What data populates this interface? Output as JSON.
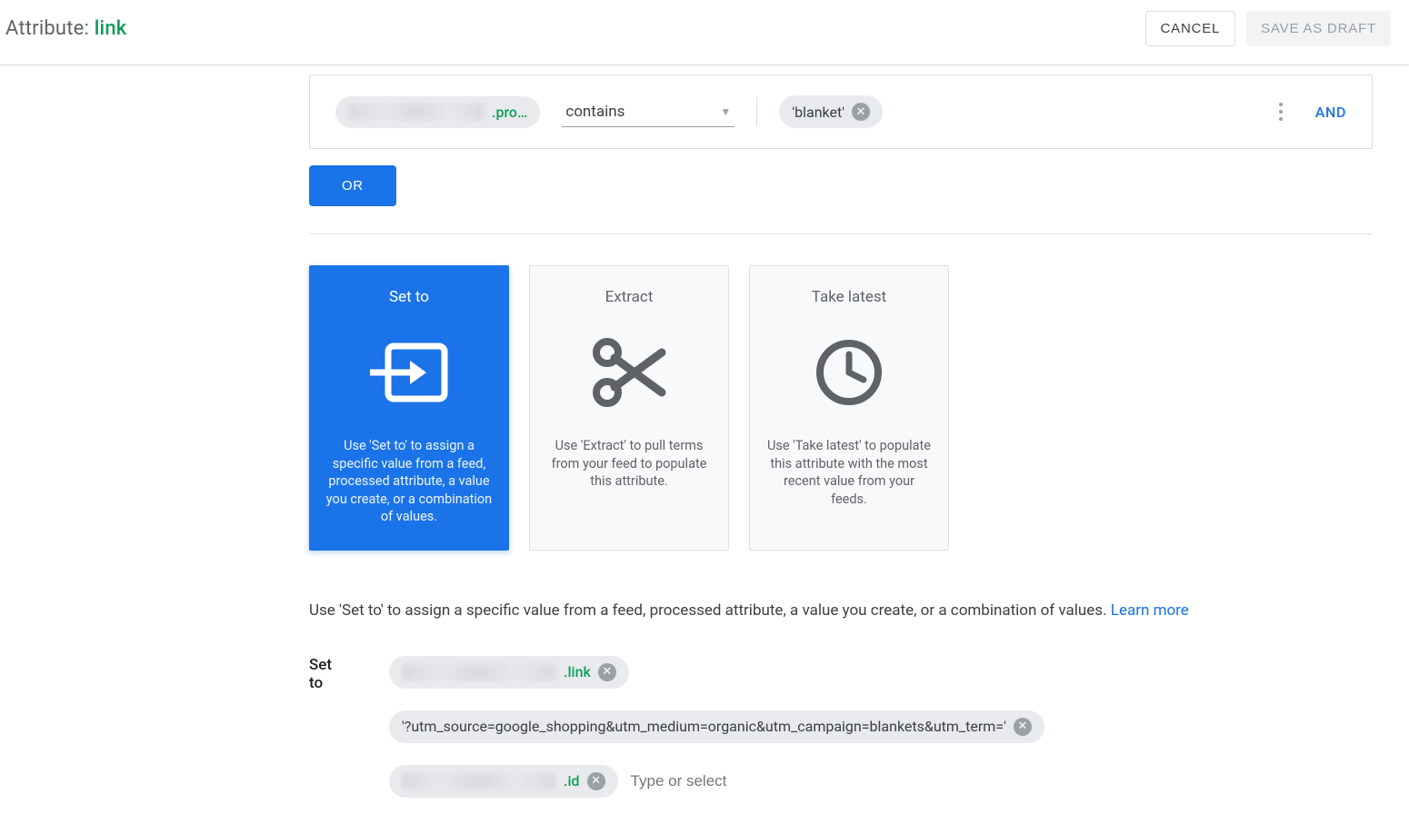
{
  "header": {
    "title_prefix": "Attribute: ",
    "title_attr": "link",
    "cancel": "CANCEL",
    "save": "SAVE AS DRAFT"
  },
  "rule": {
    "field_suffix": ".pro…",
    "operator": "contains",
    "value": "'blanket'",
    "and": "AND"
  },
  "or_button": "OR",
  "cards": {
    "set_to": {
      "title": "Set to",
      "desc": "Use 'Set to' to assign a specific value from a feed, processed attribute, a value you create, or a combination of values."
    },
    "extract": {
      "title": "Extract",
      "desc": "Use 'Extract' to pull terms from your feed to populate this attribute."
    },
    "take_latest": {
      "title": "Take latest",
      "desc": "Use 'Take latest' to populate this attribute with the most recent value from your feeds."
    }
  },
  "helper_text": "Use 'Set to' to assign a specific value from a feed, processed attribute, a value you create, or a combination of values. ",
  "learn_more": "Learn more",
  "set_to_section": {
    "label": "Set to",
    "chip1_suffix": ".link",
    "chip2": "'?utm_source=google_shopping&utm_medium=organic&utm_campaign=blankets&utm_term='",
    "chip3_suffix": ".id",
    "placeholder": "Type or select"
  }
}
